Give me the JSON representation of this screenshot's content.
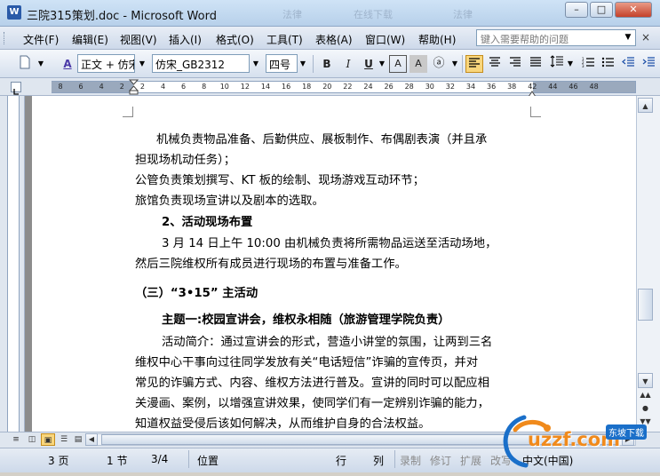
{
  "window": {
    "title": "三院315策划.doc - Microsoft Word",
    "app_icon_text": "W",
    "ghost_tab_1": "法律",
    "ghost_tab_2": "在线下载",
    "ghost_tab_3": "法律",
    "buttons": {
      "minimize": "–",
      "maximize": "□",
      "close": "✕"
    }
  },
  "menu": {
    "items": [
      "文件(F)",
      "编辑(E)",
      "视图(V)",
      "插入(I)",
      "格式(O)",
      "工具(T)",
      "表格(A)",
      "窗口(W)",
      "帮助(H)"
    ],
    "help_placeholder": "键入需要帮助的问题",
    "close_doc": "×"
  },
  "toolbar": {
    "style": "正文 + 仿宋",
    "font": "仿宋_GB2312",
    "size": "四号",
    "bold": "B",
    "italic": "I",
    "underline": "U",
    "style_icon_label": "A"
  },
  "ruler": {
    "ticks": [
      "8",
      "6",
      "4",
      "2",
      "2",
      "4",
      "6",
      "8",
      "10",
      "12",
      "14",
      "16",
      "18",
      "20",
      "22",
      "24",
      "26",
      "28",
      "30",
      "32",
      "34",
      "36",
      "38",
      "42",
      "44",
      "46",
      "48"
    ]
  },
  "document": {
    "lines": [
      {
        "text": "机械负责物品准备、后勤供应、展板制作、布偶剧表演（并且承",
        "bold": false
      },
      {
        "text": "担现场机动任务）；",
        "bold": false
      },
      {
        "text": "公管负责策划撰写、KT 板的绘制、现场游戏互动环节；",
        "bold": false
      },
      {
        "text": "旅馆负责现场宣讲以及剧本的选取。",
        "bold": false
      },
      {
        "text": "2、活动现场布置",
        "bold": true
      },
      {
        "text": "3 月 14 日上午 10:00 由机械负责将所需物品运送至活动场地，",
        "bold": false
      },
      {
        "text": "然后三院维权所有成员进行现场的布置与准备工作。",
        "bold": false
      },
      {
        "text": "（三）“3•15” 主活动",
        "bold": true
      },
      {
        "text": "主题一:校园宣讲会，维权永相随（旅游管理学院负责）",
        "bold": true
      },
      {
        "text": "活动简介：通过宣讲会的形式，营造小讲堂的氛围，让两到三名",
        "bold": false
      },
      {
        "text": "维权中心干事向过往同学发放有关“电话短信”诈骗的宣传页，并对",
        "bold": false
      },
      {
        "text": "常见的诈骗方式、内容、维权方法进行普及。宣讲的同时可以配应相",
        "bold": false
      },
      {
        "text": "关漫画、案例，以增强宣讲效果，使同学们有一定辨别诈骗的能力，",
        "bold": false
      },
      {
        "text": "知道权益受侵后该如何解决，从而维护自身的合法权益。",
        "bold": false
      }
    ]
  },
  "statusbar": {
    "page": "3 页",
    "section": "1 节",
    "page_of": "3/4",
    "position": "位置",
    "line": "行",
    "column": "列",
    "record": "录制",
    "revise": "修订",
    "extend": "扩展",
    "overwrite": "改写",
    "language": "中文(中国)"
  },
  "watermark": {
    "brand": "uzzf.com",
    "tag": "东坡下载"
  },
  "colors": {
    "title_bar": "#c4daf1",
    "doc_background": "#8c8c8c",
    "active_button": "#f9d67c",
    "watermark_orange": "#f08a1c",
    "watermark_blue": "#1a6fc9"
  }
}
